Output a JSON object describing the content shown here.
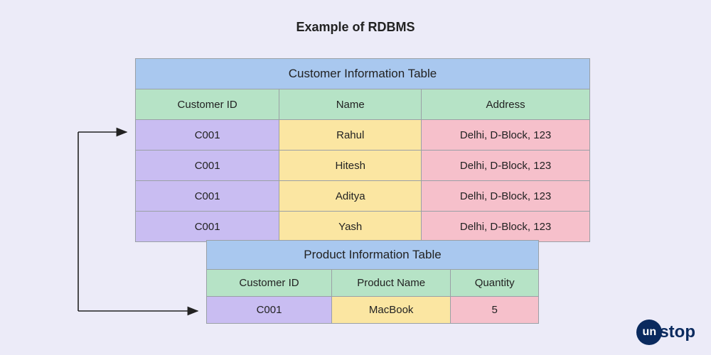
{
  "title": "Example of RDBMS",
  "customer_table": {
    "title": "Customer Information Table",
    "columns": [
      "Customer ID",
      "Name",
      "Address"
    ],
    "rows": [
      {
        "id": "C001",
        "name": "Rahul",
        "address": "Delhi, D-Block, 123"
      },
      {
        "id": "C001",
        "name": "Hitesh",
        "address": "Delhi, D-Block, 123"
      },
      {
        "id": "C001",
        "name": "Aditya",
        "address": "Delhi, D-Block, 123"
      },
      {
        "id": "C001",
        "name": "Yash",
        "address": "Delhi, D-Block, 123"
      }
    ]
  },
  "product_table": {
    "title": "Product Information Table",
    "columns": [
      "Customer ID",
      "Product Name",
      "Quantity"
    ],
    "rows": [
      {
        "id": "C001",
        "name": "MacBook",
        "qty": "5"
      }
    ]
  },
  "logo": {
    "circle": "un",
    "rest": "stop"
  }
}
